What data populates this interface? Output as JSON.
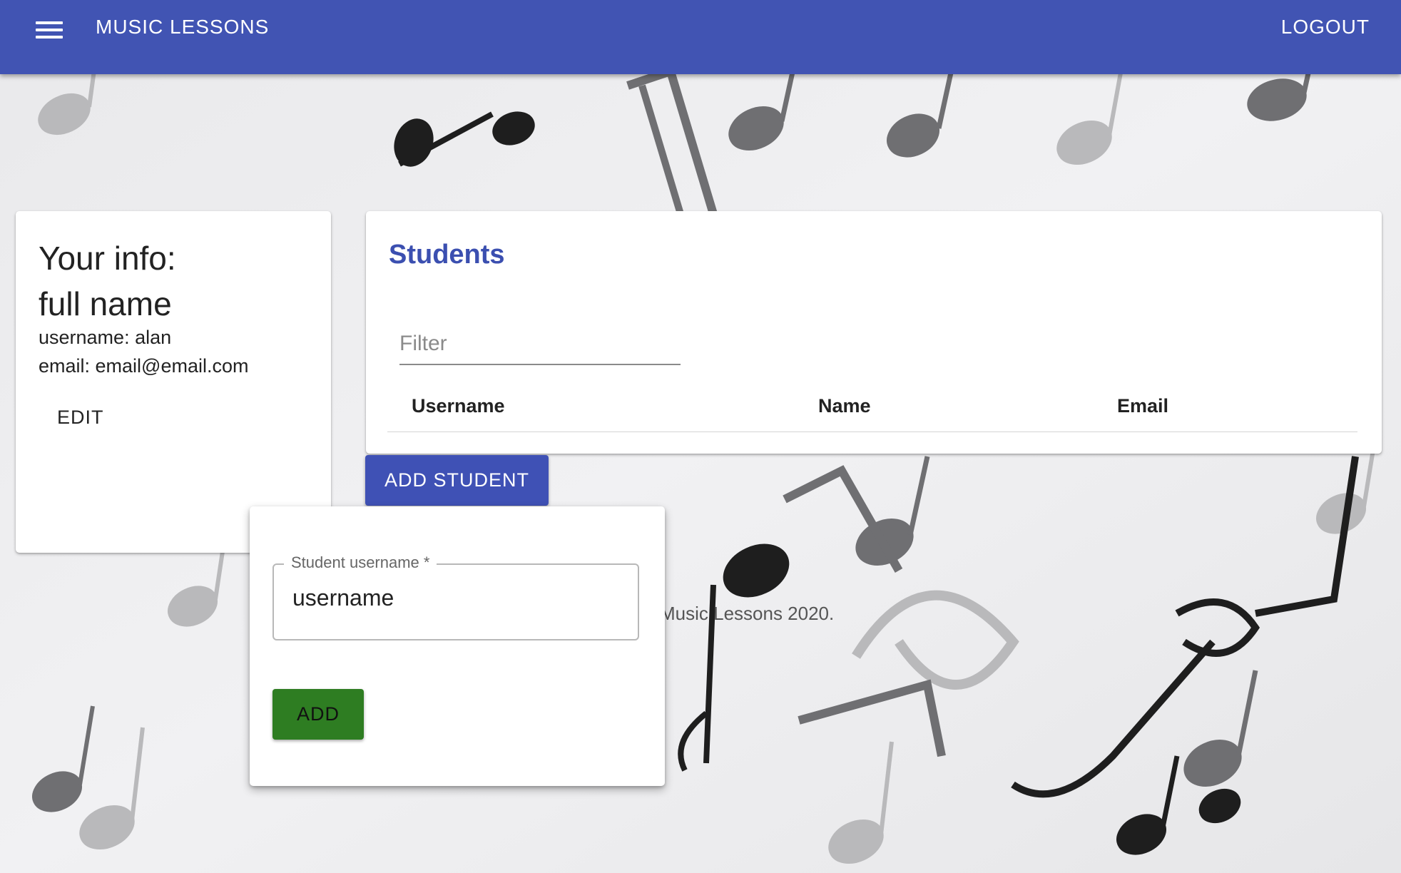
{
  "appbar": {
    "menu_icon": "hamburger-menu-icon",
    "title": "MUSIC LESSONS",
    "logout_label": "LOGOUT",
    "color": "#4154b3"
  },
  "info": {
    "heading": "Your info:",
    "full_name": "full name",
    "username_line": "username: alan",
    "email_line": "email: email@email.com",
    "edit_label": "EDIT"
  },
  "students": {
    "title": "Students",
    "filter_placeholder": "Filter",
    "columns": [
      "Username",
      "Name",
      "Email"
    ],
    "add_label": "ADD STUDENT"
  },
  "popover": {
    "field_label": "Student username *",
    "field_value": "username",
    "add_label": "ADD",
    "add_color": "#2e7d22"
  },
  "footer": {
    "text": "Music Lessons 2020."
  }
}
